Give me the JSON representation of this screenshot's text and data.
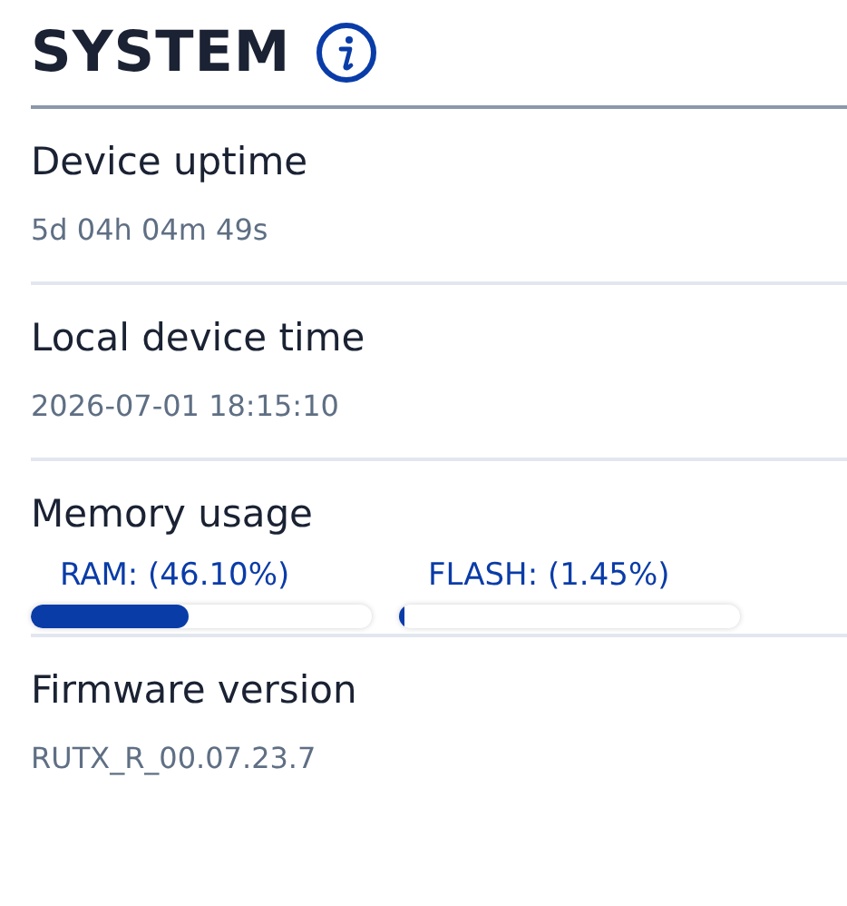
{
  "title": "SYSTEM",
  "rows": [
    {
      "kind": "text",
      "label": "Device uptime",
      "value": "5d 04h 04m 49s"
    },
    {
      "kind": "text",
      "label": "Local device time",
      "value": "2026-07-01 18:15:10"
    },
    {
      "kind": "meters",
      "label": "Memory usage",
      "meters": [
        {
          "label": "RAM: (46.10%)",
          "level": 0.461
        },
        {
          "label": "FLASH: (1.45%)",
          "level": 0.0145
        }
      ]
    },
    {
      "kind": "text",
      "label": "Firmware version",
      "value": "RUTX_R_00.07.23.7"
    }
  ]
}
